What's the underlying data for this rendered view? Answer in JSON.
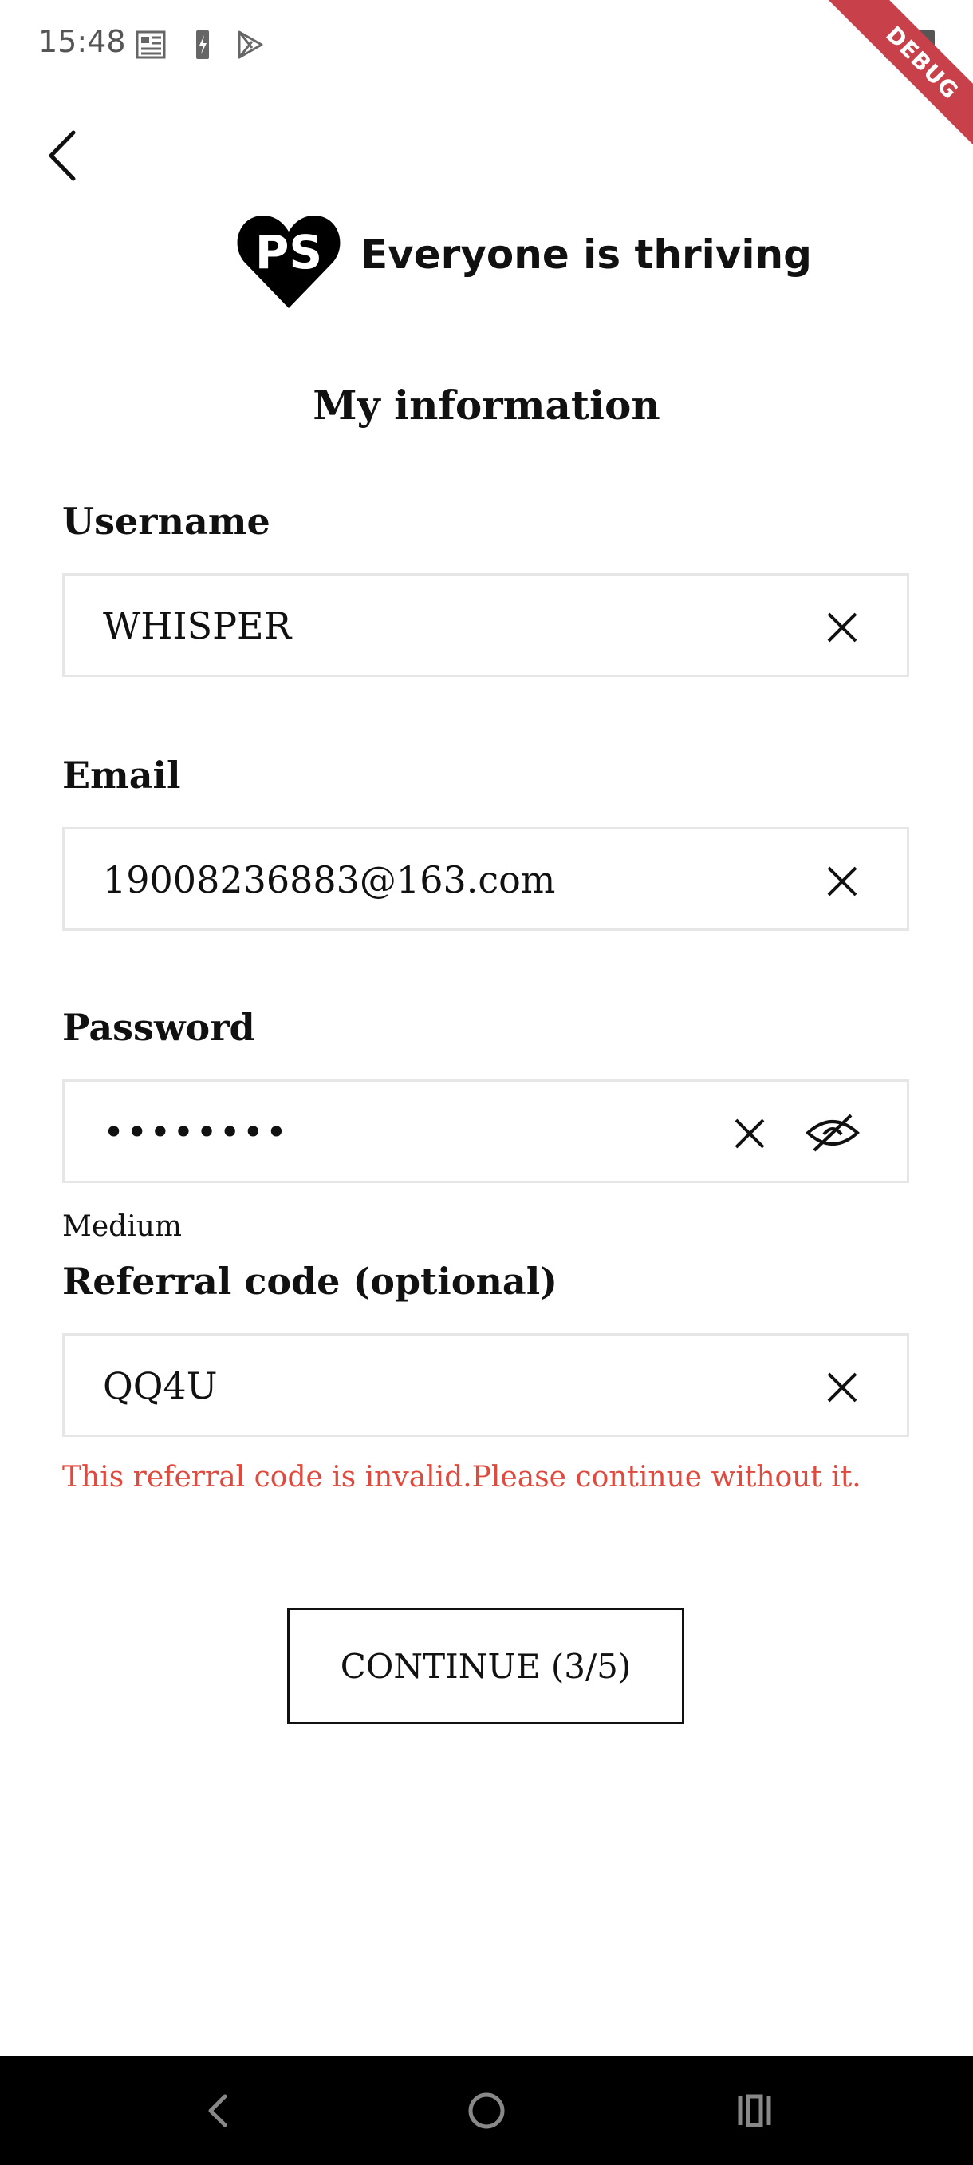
{
  "status_bar": {
    "time": "15:48",
    "icons": [
      "news-icon",
      "battery-icon",
      "play-store-icon",
      "wifi-icon",
      "battery-full-icon"
    ]
  },
  "debug_banner": "DEBUG",
  "header": {
    "logo_text": "PS",
    "tagline": "Everyone is thriving",
    "title": "My information"
  },
  "form": {
    "username": {
      "label": "Username",
      "value": "WHISPER"
    },
    "email": {
      "label": "Email",
      "value": "19008236883@163.com"
    },
    "password": {
      "label": "Password",
      "value": "••••••••",
      "strength": "Medium"
    },
    "referral": {
      "label": "Referral code (optional)",
      "value": "QQ4U",
      "error": "This referral code is invalid.Please continue without it."
    }
  },
  "continue_button": "CONTINUE (3/5)",
  "colors": {
    "error": "#e04a3e",
    "debug": "#c8414a",
    "border": "#e6e6e6"
  }
}
